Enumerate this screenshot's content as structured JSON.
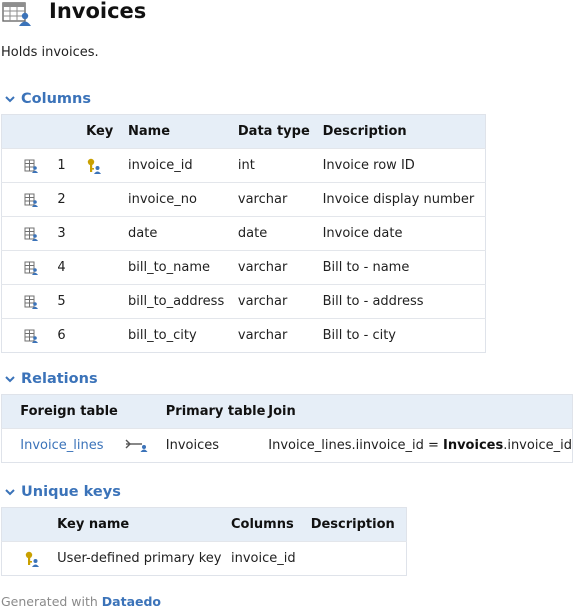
{
  "page": {
    "title": "Invoices",
    "description": "Holds invoices."
  },
  "columns_section": {
    "heading": "Columns",
    "headers": {
      "key": "Key",
      "name": "Name",
      "data_type": "Data type",
      "description": "Description"
    },
    "rows": [
      {
        "num": "1",
        "is_key": true,
        "name": "invoice_id",
        "data_type": "int",
        "description": "Invoice row ID"
      },
      {
        "num": "2",
        "is_key": false,
        "name": "invoice_no",
        "data_type": "varchar",
        "description": "Invoice display number"
      },
      {
        "num": "3",
        "is_key": false,
        "name": "date",
        "data_type": "date",
        "description": "Invoice date"
      },
      {
        "num": "4",
        "is_key": false,
        "name": "bill_to_name",
        "data_type": "varchar",
        "description": "Bill to - name"
      },
      {
        "num": "5",
        "is_key": false,
        "name": "bill_to_address",
        "data_type": "varchar",
        "description": "Bill to - address"
      },
      {
        "num": "6",
        "is_key": false,
        "name": "bill_to_city",
        "data_type": "varchar",
        "description": "Bill to - city"
      }
    ]
  },
  "relations_section": {
    "heading": "Relations",
    "headers": {
      "foreign_table": "Foreign table",
      "primary_table": "Primary table",
      "join": "Join"
    },
    "rows": [
      {
        "foreign_table": "Invoice_lines",
        "primary_table": "Invoices",
        "join_prefix": "Invoice_lines.iinvoice_id = ",
        "join_bold": "Invoices",
        "join_suffix": ".invoice_id"
      }
    ]
  },
  "unique_keys_section": {
    "heading": "Unique keys",
    "headers": {
      "key_name": "Key name",
      "columns": "Columns",
      "description": "Description"
    },
    "rows": [
      {
        "key_name": "User-defined primary key",
        "columns": "invoice_id",
        "description": ""
      }
    ]
  },
  "footer": {
    "prefix": "Generated with ",
    "brand": "Dataedo"
  },
  "icons": {
    "table": "table-user-icon",
    "column": "column-icon",
    "key": "primary-key-icon",
    "relation": "relation-arrow-icon",
    "chevron": "chevron-down-icon"
  },
  "colors": {
    "accent": "#3b73b9",
    "header_bg": "#e6eef7",
    "key_yellow": "#c9a000"
  }
}
